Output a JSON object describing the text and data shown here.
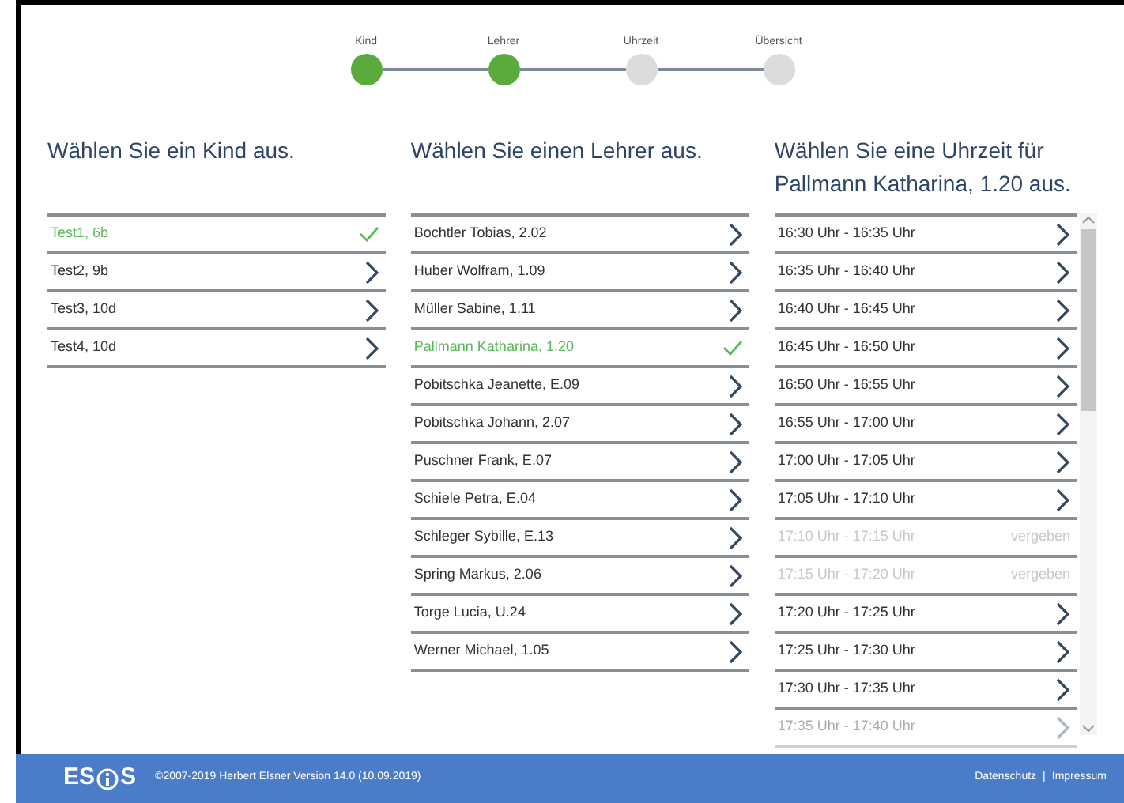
{
  "steps": [
    {
      "label": "Kind",
      "done": true
    },
    {
      "label": "Lehrer",
      "done": true
    },
    {
      "label": "Uhrzeit",
      "done": false
    },
    {
      "label": "Übersicht",
      "done": false
    }
  ],
  "columns": [
    {
      "heading": "Wählen Sie ein Kind aus.",
      "items": [
        {
          "label": "Test1, 6b",
          "selected": true
        },
        {
          "label": "Test2, 9b",
          "selected": false
        },
        {
          "label": "Test3, 10d",
          "selected": false
        },
        {
          "label": "Test4, 10d",
          "selected": false
        }
      ]
    },
    {
      "heading": "Wählen Sie einen Lehrer aus.",
      "items": [
        {
          "label": "Bochtler Tobias, 2.02",
          "selected": false
        },
        {
          "label": "Huber Wolfram, 1.09",
          "selected": false
        },
        {
          "label": "Müller Sabine, 1.11",
          "selected": false
        },
        {
          "label": "Pallmann Katharina, 1.20",
          "selected": true
        },
        {
          "label": "Pobitschka Jeanette, E.09",
          "selected": false
        },
        {
          "label": "Pobitschka Johann, 2.07",
          "selected": false
        },
        {
          "label": "Puschner Frank, E.07",
          "selected": false
        },
        {
          "label": "Schiele Petra, E.04",
          "selected": false
        },
        {
          "label": "Schleger Sybille, E.13",
          "selected": false
        },
        {
          "label": "Spring Markus, 2.06",
          "selected": false
        },
        {
          "label": "Torge Lucia, U.24",
          "selected": false
        },
        {
          "label": "Werner Michael, 1.05",
          "selected": false
        }
      ]
    },
    {
      "heading": "Wählen Sie eine Uhrzeit für Pallmann Katharina, 1.20 aus.",
      "scrollable": true,
      "items": [
        {
          "label": "16:30 Uhr - 16:35 Uhr",
          "disabled": false
        },
        {
          "label": "16:35 Uhr - 16:40 Uhr",
          "disabled": false
        },
        {
          "label": "16:40 Uhr - 16:45 Uhr",
          "disabled": false
        },
        {
          "label": "16:45 Uhr - 16:50 Uhr",
          "disabled": false
        },
        {
          "label": "16:50 Uhr - 16:55 Uhr",
          "disabled": false
        },
        {
          "label": "16:55 Uhr - 17:00 Uhr",
          "disabled": false
        },
        {
          "label": "17:00 Uhr - 17:05 Uhr",
          "disabled": false
        },
        {
          "label": "17:05 Uhr - 17:10 Uhr",
          "disabled": false
        },
        {
          "label": "17:10 Uhr - 17:15 Uhr",
          "disabled": true,
          "note": "vergeben"
        },
        {
          "label": "17:15 Uhr - 17:20 Uhr",
          "disabled": true,
          "note": "vergeben"
        },
        {
          "label": "17:20 Uhr - 17:25 Uhr",
          "disabled": false
        },
        {
          "label": "17:25 Uhr - 17:30 Uhr",
          "disabled": false
        },
        {
          "label": "17:30 Uhr - 17:35 Uhr",
          "disabled": false
        },
        {
          "label": "17:35 Uhr - 17:40 Uhr",
          "disabled": false,
          "faded": true
        }
      ]
    }
  ],
  "footer": {
    "logo": "ES",
    "logo_end": "S",
    "copyright": "©2007-2019 Herbert Elsner Version 14.0 (10.09.2019)",
    "links": [
      "Datenschutz",
      "Impressum"
    ],
    "separator": "|"
  }
}
